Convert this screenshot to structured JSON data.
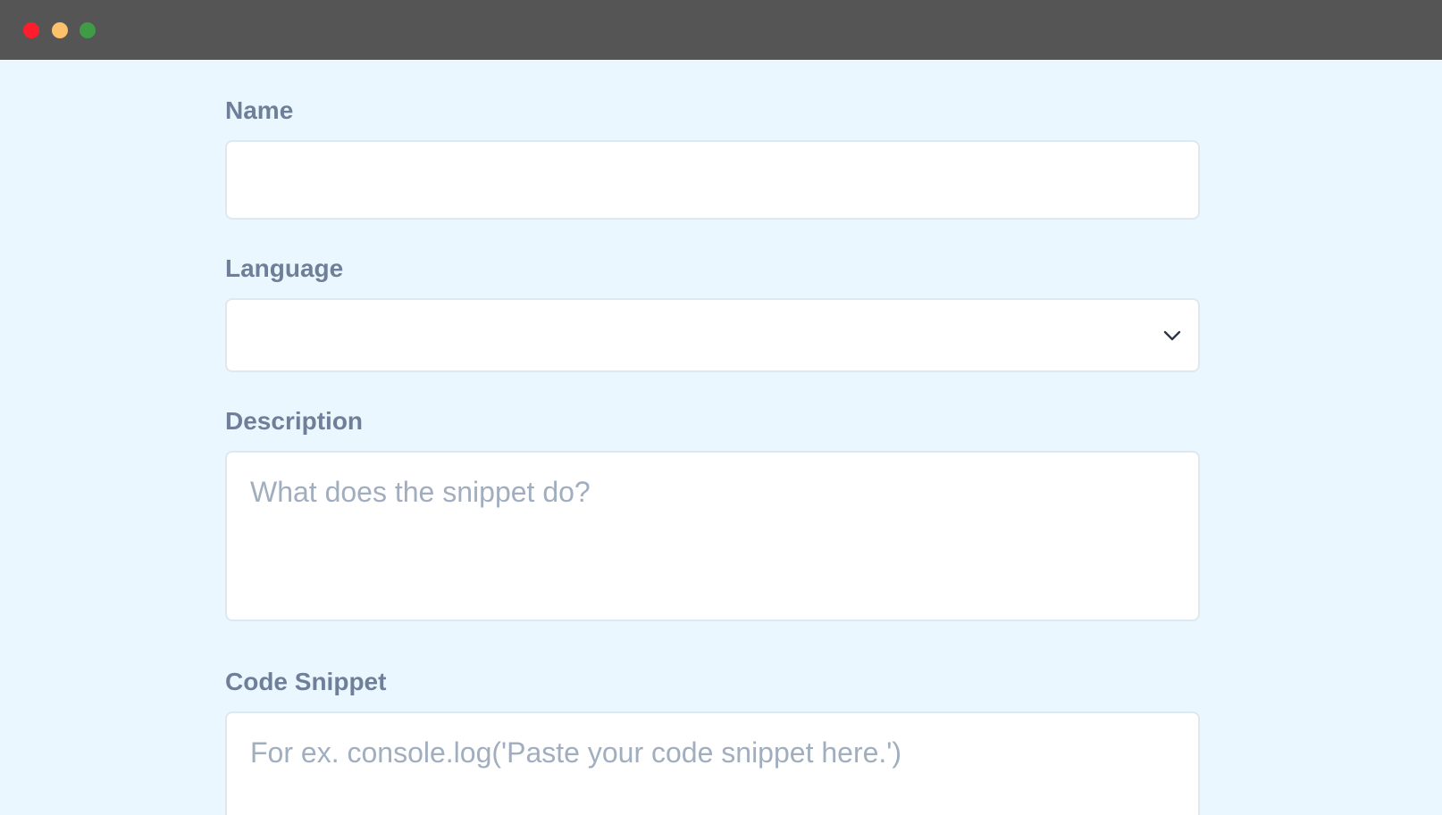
{
  "window": {
    "controls": {
      "close_color": "#fe1d2c",
      "minimize_color": "#fcc16b",
      "zoom_color": "#3f9b46"
    }
  },
  "form": {
    "name": {
      "label": "Name",
      "value": "",
      "placeholder": ""
    },
    "language": {
      "label": "Language",
      "selected": "",
      "icon": "chevron-down-icon"
    },
    "description": {
      "label": "Description",
      "value": "",
      "placeholder": "What does the snippet do?"
    },
    "code_snippet": {
      "label": "Code Snippet",
      "value": "",
      "placeholder": "For ex. console.log('Paste your code snippet here.')"
    }
  },
  "colors": {
    "background": "#eaf7fe",
    "label": "#6f7f99",
    "placeholder": "#a0aec0",
    "titlebar": "#555555"
  }
}
